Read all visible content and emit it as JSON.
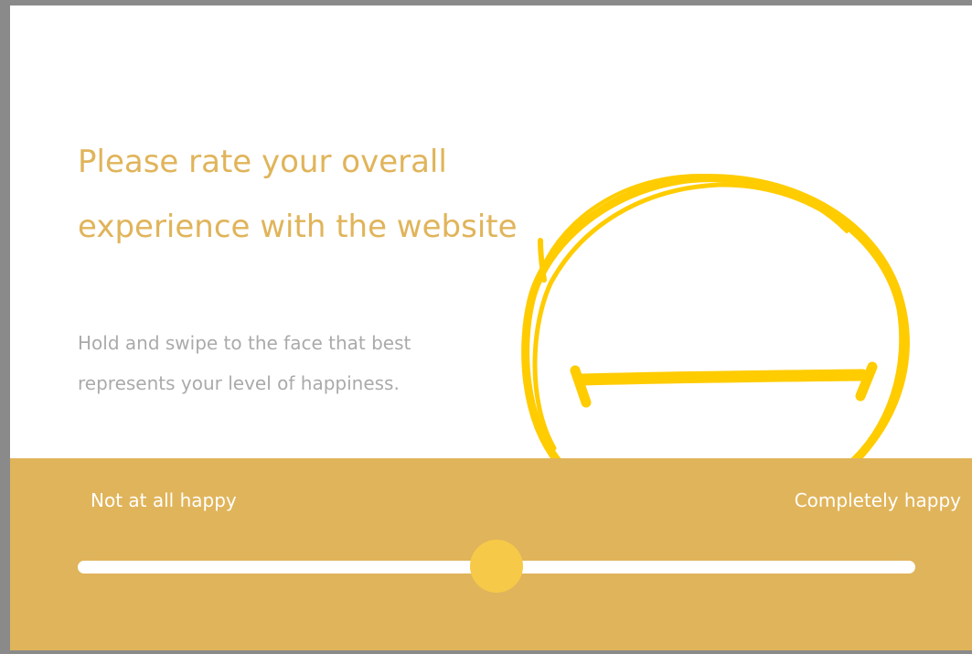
{
  "question": {
    "title": "Please rate your overall experience with the website",
    "instruction": "Hold and swipe to the face that best represents your level of happiness."
  },
  "face": {
    "expression": "neutral",
    "icon": "neutral-face-icon",
    "stroke_color": "#FFCC00"
  },
  "slider": {
    "min_label": "Not at all happy",
    "max_label": "Completely happy",
    "value_fraction": 0.5
  },
  "colors": {
    "accent": "#E0B45A",
    "thumb": "#F7C948",
    "instruction_text": "#AAAAAA"
  }
}
